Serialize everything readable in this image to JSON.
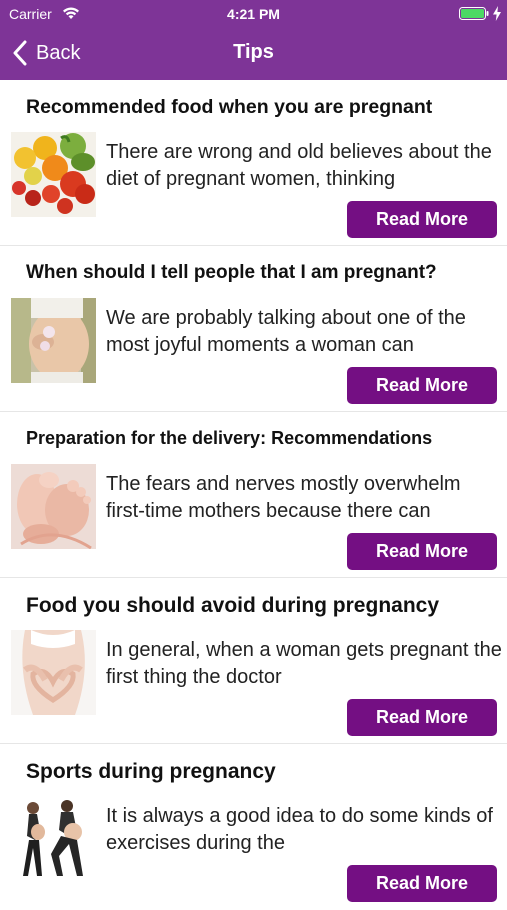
{
  "status_bar": {
    "carrier": "Carrier",
    "time": "4:21 PM",
    "icons": [
      "wifi-icon",
      "battery-icon",
      "charging-bolt-icon"
    ]
  },
  "nav": {
    "back_label": "Back",
    "title": "Tips",
    "back_icon": "chevron-left-icon"
  },
  "colors": {
    "header": "#7e3497",
    "button": "#740f83"
  },
  "tips": [
    {
      "title": "Recommended food when you are pregnant",
      "excerpt": "There are wrong and old believes about the diet of pregnant women, thinking",
      "button": "Read More",
      "image": "fruits-vegetables-photo"
    },
    {
      "title": "When should I tell people that I am pregnant?",
      "excerpt": "We are probably talking about one of the most joyful moments a woman can",
      "button": "Read More",
      "image": "pregnant-belly-photo"
    },
    {
      "title": "Preparation for the delivery: Recommendations",
      "excerpt": "The fears and nerves mostly overwhelm first-time mothers because there can",
      "button": "Read More",
      "image": "baby-feet-photo"
    },
    {
      "title": "Food you should avoid during pregnancy",
      "excerpt": "In general, when a woman gets pregnant the first thing the doctor",
      "button": "Read More",
      "image": "heart-hands-belly-photo"
    },
    {
      "title": "Sports during pregnancy",
      "excerpt": "It is always a good idea to do some kinds of exercises during the",
      "button": "Read More",
      "image": "pregnant-exercise-photo"
    }
  ]
}
